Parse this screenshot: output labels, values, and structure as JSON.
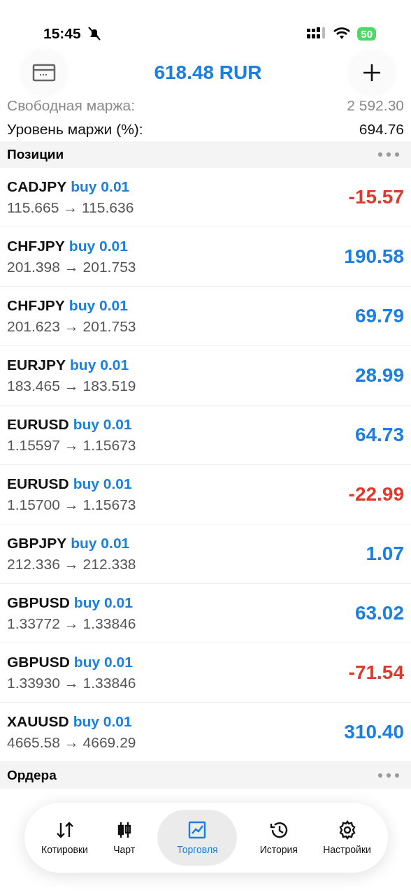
{
  "status_bar": {
    "time": "15:45",
    "battery": "50"
  },
  "header": {
    "balance": "618.48 RUR"
  },
  "summary": [
    {
      "label": "Свободная маржа:",
      "value": "2 592.30",
      "faded": true
    },
    {
      "label": "Уровень маржи (%):",
      "value": "694.76",
      "faded": false
    }
  ],
  "positions": {
    "title": "Позиции",
    "rows": [
      {
        "symbol": "CADJPY",
        "side": "buy 0.01",
        "prices": "115.665 → 115.636",
        "profit": "-15.57",
        "loss": true
      },
      {
        "symbol": "CHFJPY",
        "side": "buy 0.01",
        "prices": "201.398 → 201.753",
        "profit": "190.58",
        "loss": false
      },
      {
        "symbol": "CHFJPY",
        "side": "buy 0.01",
        "prices": "201.623 → 201.753",
        "profit": "69.79",
        "loss": false
      },
      {
        "symbol": "EURJPY",
        "side": "buy 0.01",
        "prices": "183.465 → 183.519",
        "profit": "28.99",
        "loss": false
      },
      {
        "symbol": "EURUSD",
        "side": "buy 0.01",
        "prices": "1.15597 → 1.15673",
        "profit": "64.73",
        "loss": false
      },
      {
        "symbol": "EURUSD",
        "side": "buy 0.01",
        "prices": "1.15700 → 1.15673",
        "profit": "-22.99",
        "loss": true
      },
      {
        "symbol": "GBPJPY",
        "side": "buy 0.01",
        "prices": "212.336 → 212.338",
        "profit": "1.07",
        "loss": false
      },
      {
        "symbol": "GBPUSD",
        "side": "buy 0.01",
        "prices": "1.33772 → 1.33846",
        "profit": "63.02",
        "loss": false
      },
      {
        "symbol": "GBPUSD",
        "side": "buy 0.01",
        "prices": "1.33930 → 1.33846",
        "profit": "-71.54",
        "loss": true
      },
      {
        "symbol": "XAUUSD",
        "side": "buy 0.01",
        "prices": "4665.58 → 4669.29",
        "profit": "310.40",
        "loss": false
      }
    ]
  },
  "orders": {
    "title": "Ордера"
  },
  "tab_bar": [
    {
      "label": "Котировки",
      "kind": "quotes",
      "selected": false
    },
    {
      "label": "Чарт",
      "kind": "chart",
      "selected": false
    },
    {
      "label": "Торговля",
      "kind": "trade",
      "selected": true
    },
    {
      "label": "История",
      "kind": "history",
      "selected": false
    },
    {
      "label": "Настройки",
      "kind": "settings",
      "selected": false
    }
  ]
}
